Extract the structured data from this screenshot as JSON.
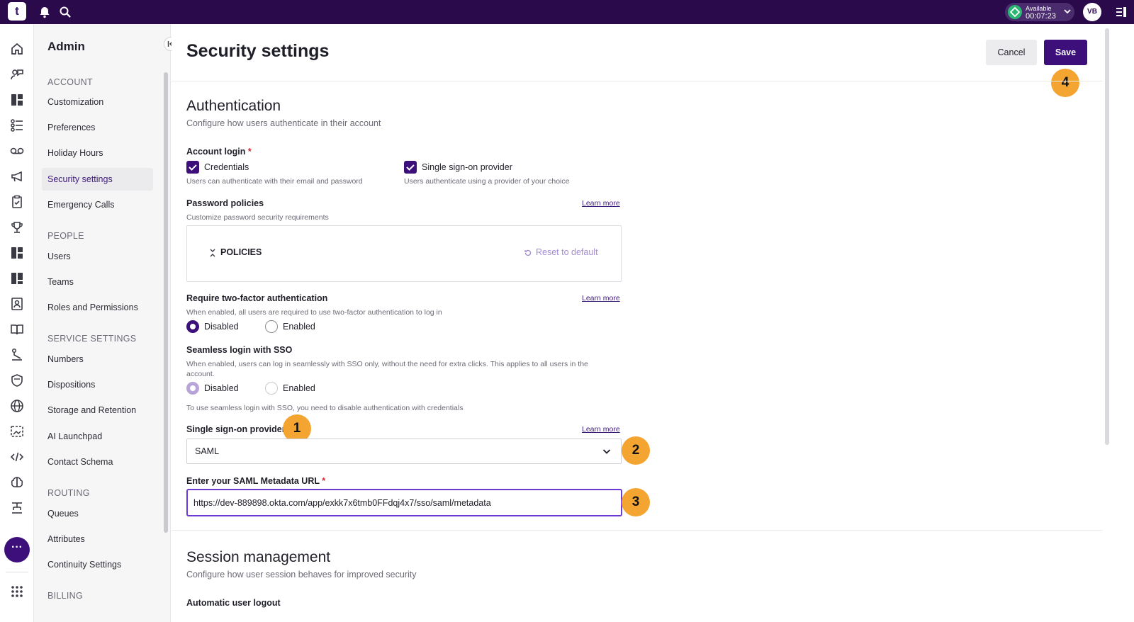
{
  "topbar": {
    "logo_text": "t",
    "status_label": "Available",
    "status_time": "00:07:23",
    "avatar_initials": "VB"
  },
  "sidebar": {
    "title": "Admin",
    "sections": [
      {
        "title": "ACCOUNT",
        "items": [
          "Customization",
          "Preferences",
          "Holiday Hours",
          "Security settings",
          "Emergency Calls"
        ]
      },
      {
        "title": "PEOPLE",
        "items": [
          "Users",
          "Teams",
          "Roles and Permissions"
        ]
      },
      {
        "title": "SERVICE SETTINGS",
        "items": [
          "Numbers",
          "Dispositions",
          "Storage and Retention",
          "AI Launchpad",
          "Contact Schema"
        ]
      },
      {
        "title": "ROUTING",
        "items": [
          "Queues",
          "Attributes",
          "Continuity Settings"
        ]
      },
      {
        "title": "BILLING",
        "items": []
      }
    ],
    "active_item": "Security settings"
  },
  "rail": {
    "more_label": "···"
  },
  "header": {
    "title": "Security settings",
    "cancel_label": "Cancel",
    "save_label": "Save"
  },
  "authentication": {
    "title": "Authentication",
    "subtitle": "Configure how users authenticate in their account",
    "account_login": {
      "label": "Account login",
      "required_mark": "*",
      "credentials": {
        "label": "Credentials",
        "hint": "Users can authenticate with their email and password",
        "checked": true
      },
      "sso": {
        "label": "Single sign-on provider",
        "hint": "Users authenticate using a provider of your choice",
        "checked": true
      }
    },
    "password_policies": {
      "label": "Password policies",
      "hint": "Customize password security requirements",
      "learn_more": "Learn more",
      "policies_label": "POLICIES",
      "reset_label": "Reset to default"
    },
    "two_factor": {
      "label": "Require two-factor authentication",
      "hint": "When enabled, all users are required to use two-factor authentication to log in",
      "learn_more": "Learn more",
      "options": [
        "Disabled",
        "Enabled"
      ],
      "selected": "Disabled"
    },
    "seamless_sso": {
      "label": "Seamless login with SSO",
      "hint_line1": "When enabled, users can log in seamlessly with SSO only, without the need for extra clicks. This applies to all users in the",
      "hint_line2": "account.",
      "options": [
        "Disabled",
        "Enabled"
      ],
      "selected": "Disabled",
      "note": "To use seamless login with SSO, you need to disable authentication with credentials"
    },
    "sso_provider": {
      "label": "Single sign-on provider",
      "learn_more": "Learn more",
      "value": "SAML"
    },
    "saml_url": {
      "label": "Enter your SAML Metadata URL",
      "required_mark": "*",
      "value": "https://dev-889898.okta.com/app/exkk7x6tmb0FFdqj4x7/sso/saml/metadata"
    }
  },
  "session_management": {
    "title": "Session management",
    "subtitle": "Configure how user session behaves for improved security",
    "automatic_logout_label": "Automatic user logout"
  },
  "annotations": {
    "badge_1": "1",
    "badge_2": "2",
    "badge_3": "3",
    "badge_4": "4"
  },
  "colors": {
    "topbar_bg": "#2b0a4c",
    "accent": "#3d0f7a",
    "status_green": "#2bb673",
    "badge_orange": "#f4a431",
    "focus_border": "#6d3bd2"
  }
}
